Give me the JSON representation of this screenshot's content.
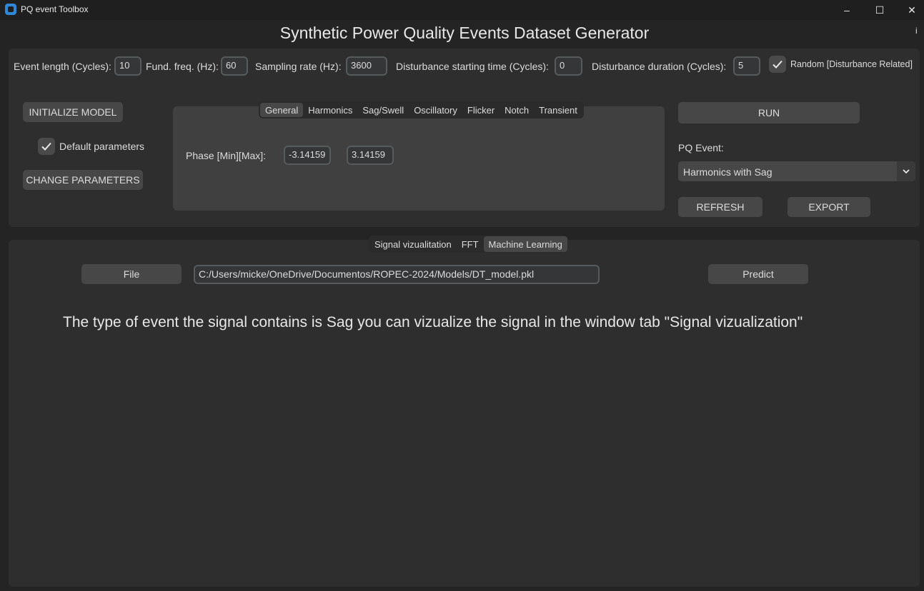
{
  "window": {
    "title": "PQ event Toolbox",
    "minimize": "–",
    "maximize": "☐",
    "close": "✕"
  },
  "header": {
    "title": "Synthetic Power Quality Events Dataset Generator",
    "info": "i"
  },
  "params": {
    "event_length_label": "Event length (Cycles):",
    "event_length_value": "10",
    "fund_freq_label": "Fund. freq. (Hz):",
    "fund_freq_value": "60",
    "sampling_rate_label": "Sampling rate (Hz):",
    "sampling_rate_value": "3600",
    "dist_start_label": "Disturbance starting time (Cycles):",
    "dist_start_value": "0",
    "dist_duration_label": "Disturbance duration (Cycles):",
    "dist_duration_value": "5",
    "random_label": "Random [Disturbance Related]",
    "random_checked": true
  },
  "left_controls": {
    "initialize_label": "INITIALIZE MODEL",
    "default_params_label": "Default parameters",
    "default_params_checked": true,
    "change_params_label": "CHANGE PARAMETERS"
  },
  "param_tabs": {
    "tabs": [
      "General",
      "Harmonics",
      "Sag/Swell",
      "Oscillatory",
      "Flicker",
      "Notch",
      "Transient"
    ],
    "active": "General",
    "phase_label": "Phase [Min][Max]:",
    "phase_min": "-3.14159",
    "phase_max": "3.14159"
  },
  "right_controls": {
    "run_label": "RUN",
    "pq_event_label": "PQ Event:",
    "pq_event_value": "Harmonics with Sag",
    "refresh_label": "REFRESH",
    "export_label": "EXPORT"
  },
  "bottom_tabs": {
    "tabs": [
      "Signal vizualitation",
      "FFT",
      "Machine Learning"
    ],
    "active": "Machine Learning"
  },
  "ml": {
    "file_label": "File",
    "file_path": "C:/Users/micke/OneDrive/Documentos/ROPEC-2024/Models/DT_model.pkl",
    "predict_label": "Predict",
    "result": "The type of event the signal contains is Sag you can vizualize the signal in the window tab \"Signal vizualization\""
  },
  "colors": {
    "background": "#242424",
    "frame": "#2e2e2e",
    "button": "#474747",
    "app_icon": "#2f87d8"
  }
}
